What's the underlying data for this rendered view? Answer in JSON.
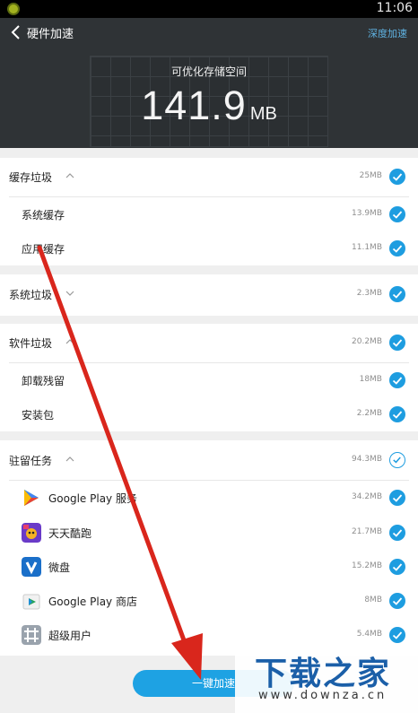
{
  "status_bar": {
    "time": "11:06"
  },
  "header": {
    "title": "硬件加速",
    "deep_accel": "深度加速",
    "space_label": "可优化存储空间",
    "space_value": "141.9",
    "space_unit": "MB"
  },
  "sections": {
    "cache": {
      "label": "缓存垃圾",
      "size": "25MB",
      "items": [
        {
          "label": "系统缓存",
          "size": "13.9MB"
        },
        {
          "label": "应用缓存",
          "size": "11.1MB"
        }
      ]
    },
    "system": {
      "label": "系统垃圾",
      "size": "2.3MB"
    },
    "software": {
      "label": "软件垃圾",
      "size": "20.2MB",
      "items": [
        {
          "label": "卸载残留",
          "size": "18MB"
        },
        {
          "label": "安装包",
          "size": "2.2MB"
        }
      ]
    },
    "resident": {
      "label": "驻留任务",
      "size": "94.3MB",
      "items": [
        {
          "label": "Google Play 服务",
          "size": "34.2MB",
          "icon": "google-play-services-icon"
        },
        {
          "label": "天天酷跑",
          "size": "21.7MB",
          "icon": "tiantian-kupao-icon"
        },
        {
          "label": "微盘",
          "size": "15.2MB",
          "icon": "weipan-icon"
        },
        {
          "label": "Google Play 商店",
          "size": "8MB",
          "icon": "google-play-store-icon"
        },
        {
          "label": "超级用户",
          "size": "5.4MB",
          "icon": "superuser-icon"
        }
      ]
    }
  },
  "action_button": "一键加速",
  "watermark": {
    "brand": "下载之家",
    "url": "www.downza.cn"
  },
  "colors": {
    "accent": "#1e9de0",
    "header_bg": "#2f3336",
    "arrow": "#d9261c"
  }
}
